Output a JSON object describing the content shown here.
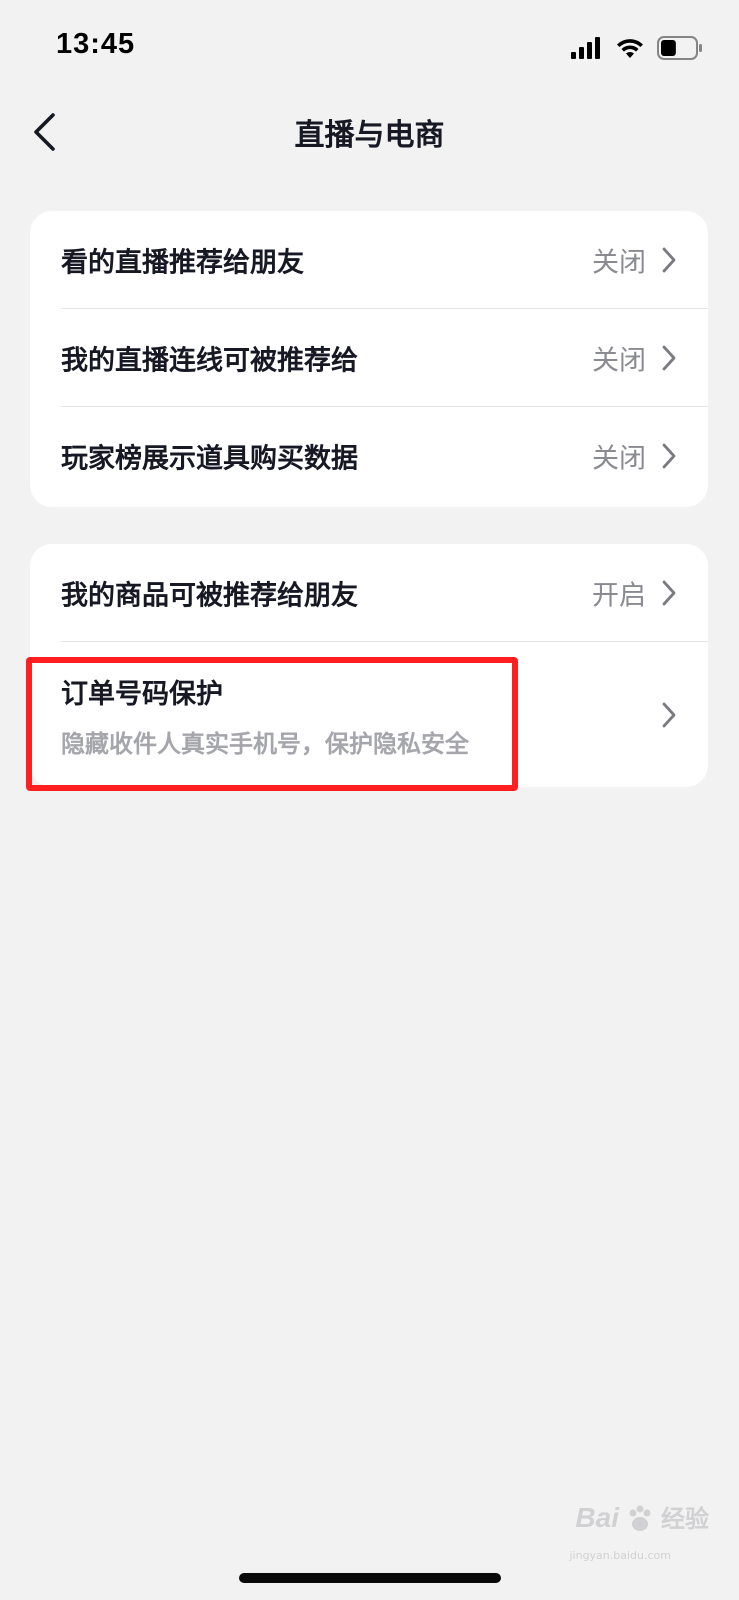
{
  "status_bar": {
    "time": "13:45",
    "icons": [
      "signal-icon",
      "wifi-icon",
      "battery-icon"
    ],
    "battery_level": 0.45
  },
  "nav": {
    "title": "直播与电商",
    "back_icon": "chevron-left-icon"
  },
  "live_section": {
    "items": [
      {
        "label": "看的直播推荐给朋友",
        "value": "关闭"
      },
      {
        "label": "我的直播连线可被推荐给",
        "value": "关闭"
      },
      {
        "label": "玩家榜展示道具购买数据",
        "value": "关闭"
      }
    ]
  },
  "commerce_section": {
    "items": [
      {
        "label": "我的商品可被推荐给朋友",
        "value": "开启"
      }
    ],
    "order_protection": {
      "title": "订单号码保护",
      "subtitle": "隐藏收件人真实手机号，保护隐私安全"
    }
  },
  "watermark": {
    "brand": "Bai",
    "suffix": "经验",
    "url": "jingyan.baidu.com"
  },
  "colors": {
    "background": "#f2f2f2",
    "card": "#ffffff",
    "primary_text": "#161823",
    "secondary_text": "#8a8b91",
    "highlight": "#ff1f1f"
  }
}
